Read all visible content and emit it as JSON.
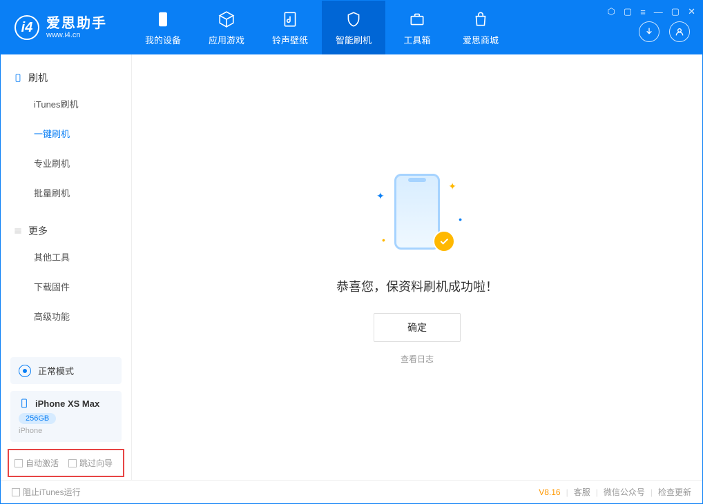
{
  "app": {
    "title": "爱思助手",
    "url": "www.i4.cn"
  },
  "nav": {
    "items": [
      {
        "label": "我的设备"
      },
      {
        "label": "应用游戏"
      },
      {
        "label": "铃声壁纸"
      },
      {
        "label": "智能刷机"
      },
      {
        "label": "工具箱"
      },
      {
        "label": "爱思商城"
      }
    ]
  },
  "sidebar": {
    "group1_title": "刷机",
    "items1": [
      {
        "label": "iTunes刷机"
      },
      {
        "label": "一键刷机"
      },
      {
        "label": "专业刷机"
      },
      {
        "label": "批量刷机"
      }
    ],
    "group2_title": "更多",
    "items2": [
      {
        "label": "其他工具"
      },
      {
        "label": "下载固件"
      },
      {
        "label": "高级功能"
      }
    ],
    "mode": "正常模式",
    "device": {
      "name": "iPhone XS Max",
      "storage": "256GB",
      "type": "iPhone"
    },
    "cbx1": "自动激活",
    "cbx2": "跳过向导"
  },
  "main": {
    "success": "恭喜您，保资料刷机成功啦！",
    "ok": "确定",
    "log": "查看日志"
  },
  "footer": {
    "block_itunes": "阻止iTunes运行",
    "version": "V8.16",
    "links": [
      "客服",
      "微信公众号",
      "检查更新"
    ]
  }
}
